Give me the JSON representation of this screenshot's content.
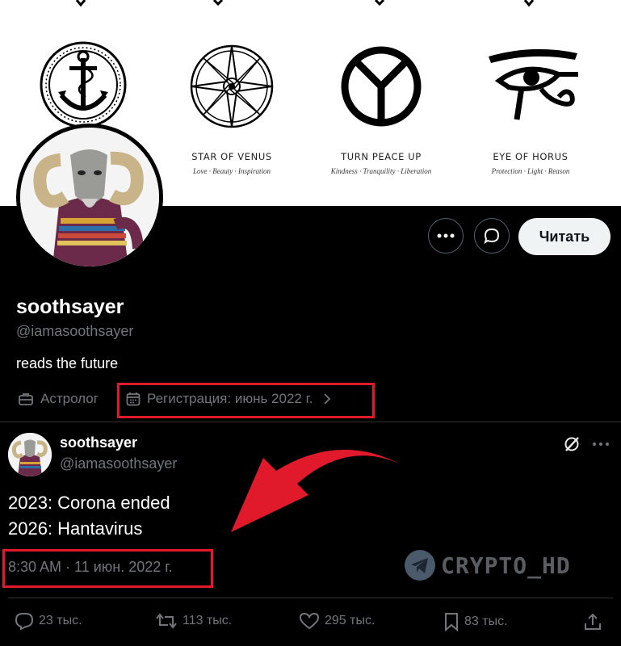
{
  "banner": {
    "symbols": [
      {
        "name": "anchor-symbol"
      },
      {
        "title": "STAR OF VENUS",
        "subtitle": "Love · Beauty · Inspiration"
      },
      {
        "title": "TURN PEACE UP",
        "subtitle": "Kindness · Tranquility · Liberation"
      },
      {
        "title": "EYE OF HORUS",
        "subtitle": "Protection · Light · Reason"
      }
    ]
  },
  "profile": {
    "display_name": "soothsayer",
    "handle": "@iamasoothsayer",
    "bio": "reads the future",
    "category": "Астролог",
    "joined": "Регистрация: июнь 2022 г.",
    "follow_label": "Читать",
    "more_icon": "more-horizontal-icon",
    "message_icon": "message-bubble-icon"
  },
  "tweet": {
    "display_name": "soothsayer",
    "handle": "@iamasoothsayer",
    "lines": [
      "2023: Corona ended",
      "2026: Hantavirus"
    ],
    "timestamp": "8:30 AM · 11 июн. 2022 г.",
    "replies": "23 тыс.",
    "retweets": "113 тыс.",
    "likes": "295 тыс.",
    "bookmarks": "83 тыс."
  },
  "watermark": {
    "text": "CRYPTO_HD",
    "icon": "telegram-icon"
  },
  "colors": {
    "highlight": "#e0192b",
    "arrow": "#e0192b",
    "follow_bg": "#eff3f4",
    "muted": "#71767b"
  }
}
